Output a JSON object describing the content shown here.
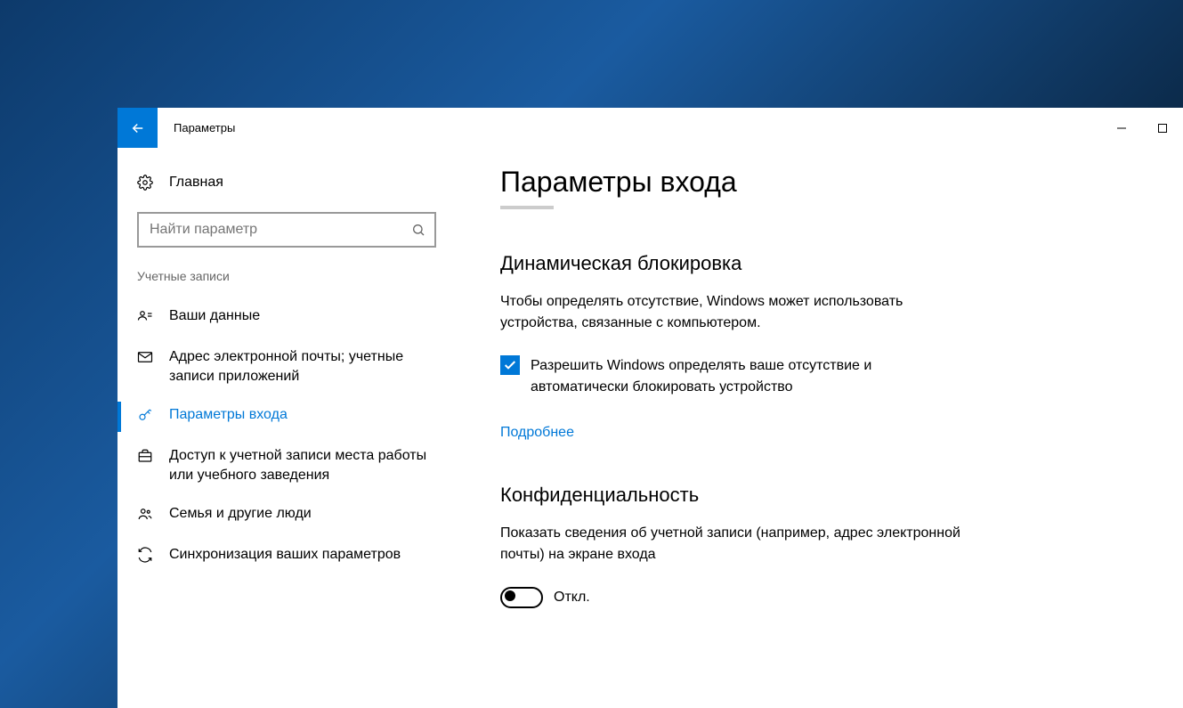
{
  "window": {
    "title": "Параметры"
  },
  "sidebar": {
    "home": "Главная",
    "search_placeholder": "Найти параметр",
    "category": "Учетные записи",
    "items": [
      {
        "label": "Ваши данные"
      },
      {
        "label": "Адрес электронной почты; учетные записи приложений"
      },
      {
        "label": "Параметры входа"
      },
      {
        "label": "Доступ к учетной записи места работы или учебного заведения"
      },
      {
        "label": "Семья и другие люди"
      },
      {
        "label": "Синхронизация ваших параметров"
      }
    ]
  },
  "content": {
    "title": "Параметры входа",
    "section1": {
      "heading": "Динамическая блокировка",
      "desc": "Чтобы определять отсутствие, Windows может использовать устройства, связанные с компьютером.",
      "checkbox_label": "Разрешить Windows определять ваше отсутствие и автоматически блокировать устройство",
      "link": "Подробнее"
    },
    "section2": {
      "heading": "Конфиденциальность",
      "desc": "Показать сведения об учетной записи (например, адрес электронной почты) на экране входа",
      "toggle_state": "Откл."
    }
  }
}
